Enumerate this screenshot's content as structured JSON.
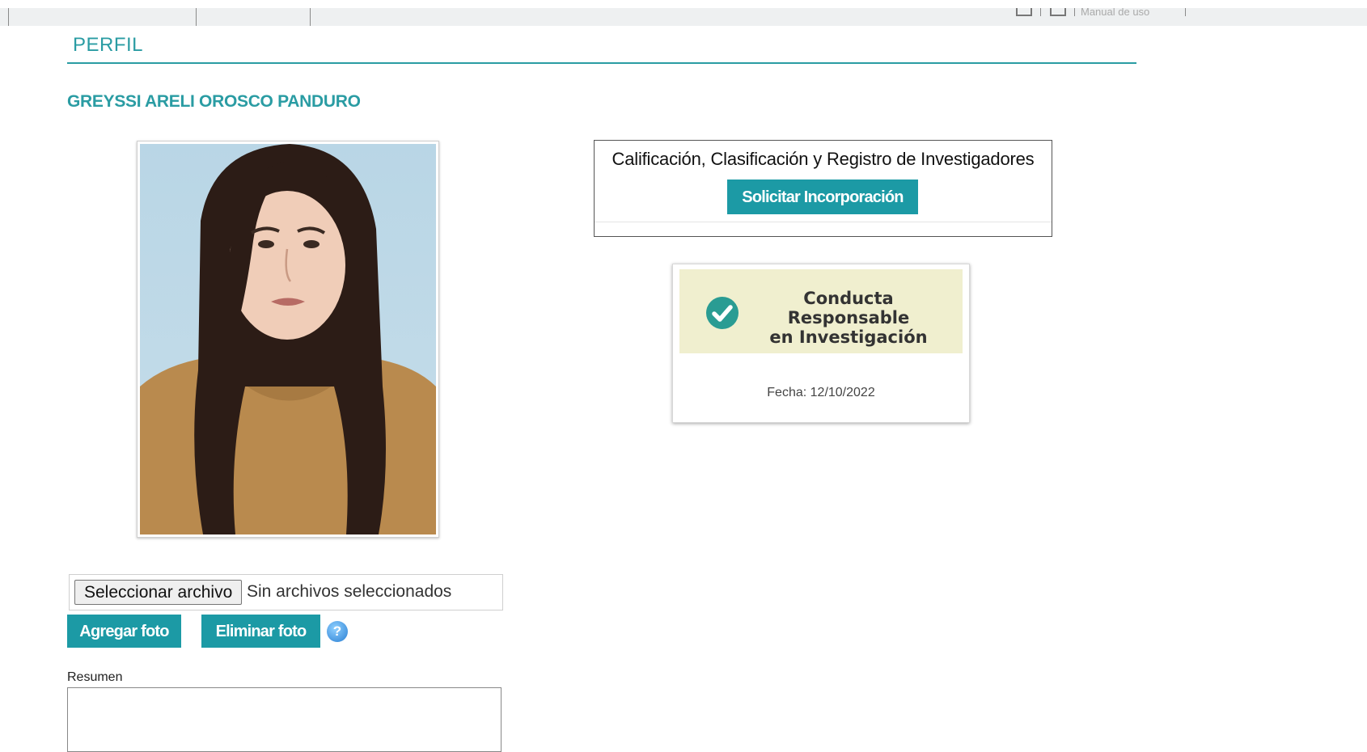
{
  "topbar": {
    "menu_text": "Manual de uso"
  },
  "profile": {
    "section_title": "PERFIL",
    "person_name": "GREYSSI ARELI OROSCO PANDURO"
  },
  "ccri": {
    "title": "Calificación, Clasificación y Registro de Investigadores",
    "request_button": "Solicitar Incorporación"
  },
  "certificate": {
    "line1": "Conducta Responsable",
    "line2": "en Investigación",
    "date_label": "Fecha: 12/10/2022"
  },
  "photo_controls": {
    "choose_file_button": "Seleccionar archivo",
    "file_status": "Sin archivos seleccionados",
    "add_photo_button": "Agregar foto",
    "delete_photo_button": "Eliminar foto",
    "help_icon_glyph": "?"
  },
  "summary": {
    "label": "Resumen",
    "value": ""
  },
  "colors": {
    "accent": "#1c9aa5",
    "heading": "#2a9ca3",
    "certificate_bg": "#f0efcf"
  }
}
